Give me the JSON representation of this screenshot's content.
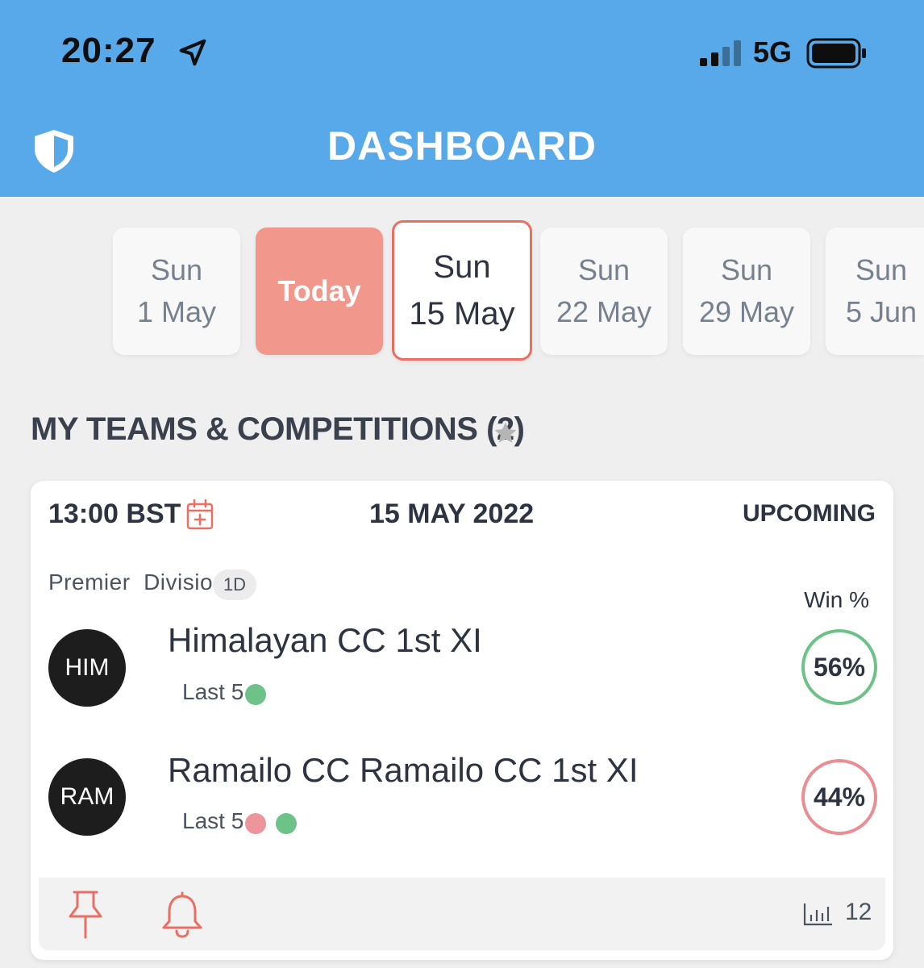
{
  "status_bar": {
    "time": "20:27",
    "network": "5G"
  },
  "header": {
    "title": "DASHBOARD",
    "color": "#58a9ea"
  },
  "date_strip": [
    {
      "day": "Sun",
      "date": "1 May",
      "state": "default"
    },
    {
      "label": "Today",
      "state": "today"
    },
    {
      "day": "Sun",
      "date": "15 May",
      "state": "selected"
    },
    {
      "day": "Sun",
      "date": "22 May",
      "state": "default"
    },
    {
      "day": "Sun",
      "date": "29 May",
      "state": "default"
    },
    {
      "day": "Sun",
      "date": "5 Jun",
      "state": "default"
    }
  ],
  "section": {
    "title": "MY TEAMS & COMPETITIONS (2)"
  },
  "match": {
    "time": "13:00 BST",
    "date": "15 MAY 2022",
    "status": "UPCOMING",
    "competition": "Premier  Division",
    "format": "1D",
    "win_header": "Win %",
    "teams": [
      {
        "abbr": "HIM",
        "name": "Himalayan CC 1st XI",
        "last5_label": "Last 5",
        "last5_results": [
          "win"
        ],
        "win_pct": "56%",
        "ring_color": "#6cc287"
      },
      {
        "abbr": "RAM",
        "name": "Ramailo CC Ramailo CC 1st XI",
        "last5_label": "Last 5",
        "last5_results": [
          "loss",
          "win"
        ],
        "win_pct": "44%",
        "ring_color": "#ea8e93"
      }
    ],
    "footer": {
      "stats_count": "12"
    }
  },
  "colors": {
    "accent": "#ea6e62",
    "today": "#f2978c",
    "win_dot": "#6cc287",
    "loss_dot": "#ec969b"
  }
}
